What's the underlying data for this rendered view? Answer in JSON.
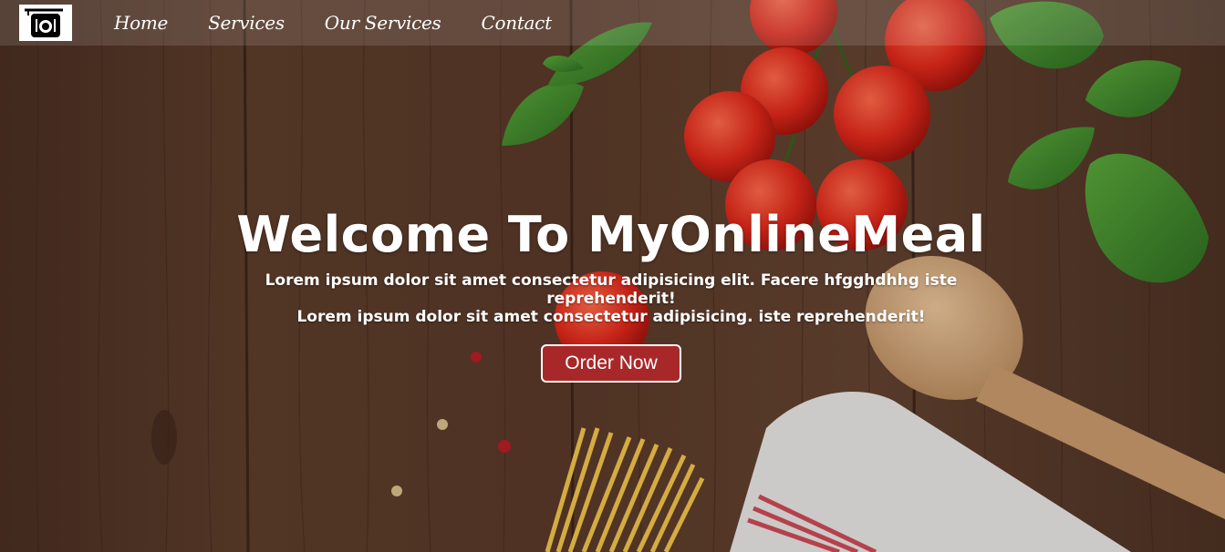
{
  "nav": {
    "items": [
      {
        "label": "Home"
      },
      {
        "label": "Services"
      },
      {
        "label": "Our Services"
      },
      {
        "label": "Contact"
      }
    ]
  },
  "hero": {
    "title": "Welcome To MyOnlineMeal",
    "line1": "Lorem ipsum dolor sit amet consectetur adipisicing elit. Facere hfgghdhhg iste reprehenderit!",
    "line2": "Lorem ipsum dolor sit amet consectetur adipisicing. iste reprehenderit!",
    "button_label": "Order Now"
  },
  "colors": {
    "button_bg": "#a8282a",
    "wood": "#5a3a28",
    "text": "#ffffff"
  },
  "icons": {
    "logo": "restaurant-sign-icon"
  }
}
